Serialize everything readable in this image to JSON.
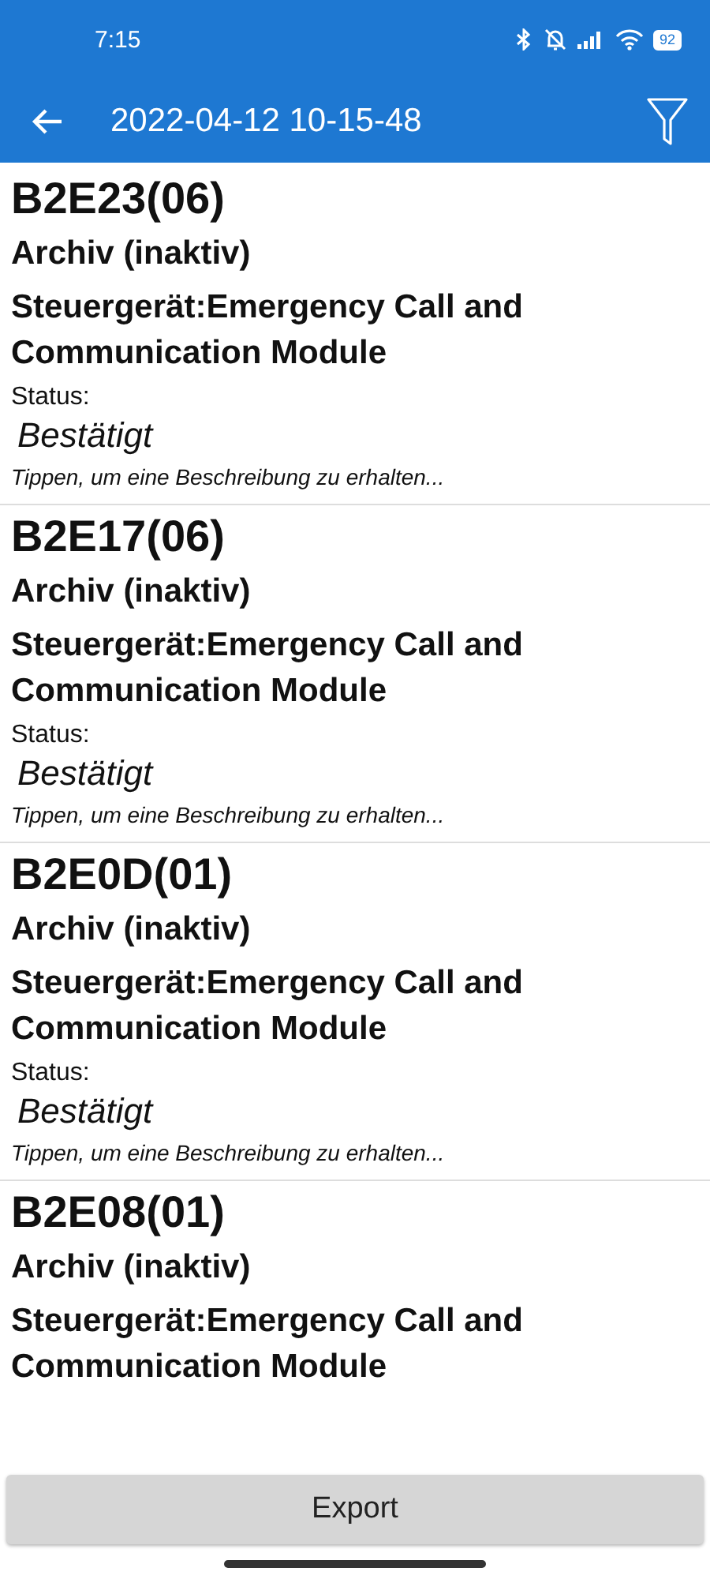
{
  "status_bar": {
    "time": "7:15",
    "battery": "92"
  },
  "app_bar": {
    "title": "2022-04-12 10-15-48"
  },
  "faults": [
    {
      "code": "B2E23(06)",
      "state": "Archiv (inaktiv)",
      "unit": "Steuergerät:Emergency Call and Communication Module",
      "status_label": "Status:",
      "status": "Bestätigt",
      "hint": "Tippen, um eine Beschreibung zu erhalten..."
    },
    {
      "code": "B2E17(06)",
      "state": "Archiv (inaktiv)",
      "unit": "Steuergerät:Emergency Call and Communication Module",
      "status_label": "Status:",
      "status": "Bestätigt",
      "hint": "Tippen, um eine Beschreibung zu erhalten..."
    },
    {
      "code": "B2E0D(01)",
      "state": "Archiv (inaktiv)",
      "unit": "Steuergerät:Emergency Call and Communication Module",
      "status_label": "Status:",
      "status": "Bestätigt",
      "hint": "Tippen, um eine Beschreibung zu erhalten..."
    },
    {
      "code": "B2E08(01)",
      "state": "Archiv (inaktiv)",
      "unit": "Steuergerät:Emergency Call and Communication Module"
    }
  ],
  "buttons": [
    "Export"
  ]
}
